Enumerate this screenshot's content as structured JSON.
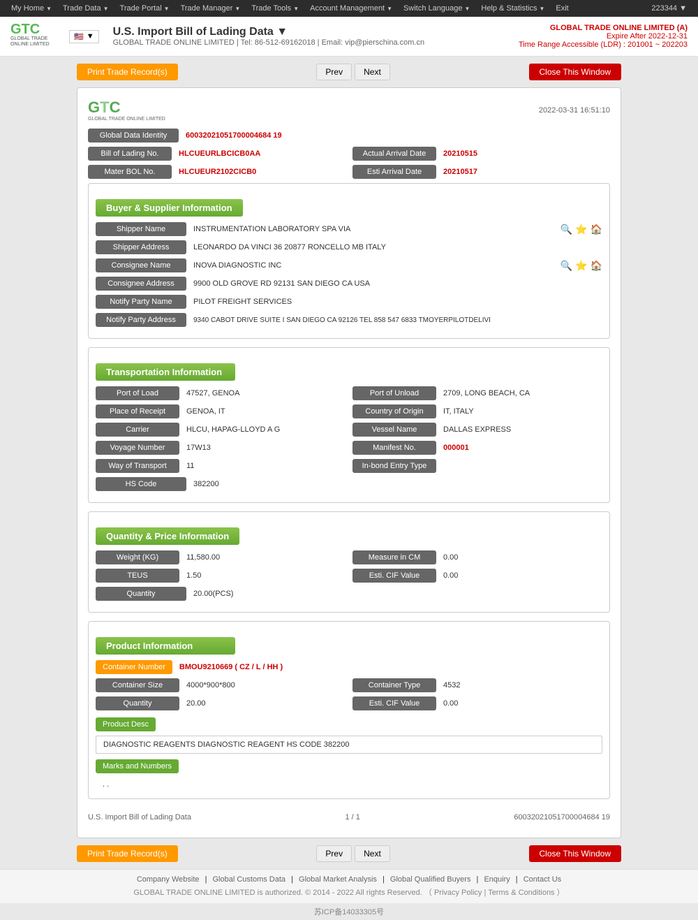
{
  "topnav": {
    "items": [
      {
        "label": "My Home",
        "arrow": true
      },
      {
        "label": "Trade Data",
        "arrow": true
      },
      {
        "label": "Trade Portal",
        "arrow": true
      },
      {
        "label": "Trade Manager",
        "arrow": true
      },
      {
        "label": "Trade Tools",
        "arrow": true
      },
      {
        "label": "Account Management",
        "arrow": true
      },
      {
        "label": "Switch Language",
        "arrow": true
      },
      {
        "label": "Help & Statistics",
        "arrow": true
      },
      {
        "label": "Exit",
        "arrow": false
      }
    ],
    "user": "223344 ▼"
  },
  "header": {
    "title": "U.S. Import Bill of Lading Data ▼",
    "subtitle": "GLOBAL TRADE ONLINE LIMITED | Tel: 86-512-69162018 | Email: vip@pierschina.com.cn",
    "company": "GLOBAL TRADE ONLINE LIMITED (A)",
    "expire": "Expire After 2022-12-31",
    "timerange": "Time Range Accessible (LDR) : 201001 ~ 202203"
  },
  "buttons": {
    "print": "Print Trade Record(s)",
    "prev": "Prev",
    "next": "Next",
    "close": "Close This Window"
  },
  "record": {
    "date": "2022-03-31 16:51:10",
    "global_data_id_label": "Global Data Identity",
    "global_data_id": "60032021051700004684 19",
    "bol_label": "Bill of Lading No.",
    "bol": "HLCUEURLBCICB0AA",
    "actual_arrival_label": "Actual Arrival Date",
    "actual_arrival": "20210515",
    "mater_bol_label": "Mater BOL No.",
    "mater_bol": "HLCUEUR2102CICB0",
    "esti_arrival_label": "Esti Arrival Date",
    "esti_arrival": "20210517"
  },
  "buyer_supplier": {
    "title": "Buyer & Supplier Information",
    "shipper_name_label": "Shipper Name",
    "shipper_name": "INSTRUMENTATION LABORATORY SPA VIA",
    "shipper_address_label": "Shipper Address",
    "shipper_address": "LEONARDO DA VINCI 36 20877 RONCELLO MB ITALY",
    "consignee_name_label": "Consignee Name",
    "consignee_name": "INOVA DIAGNOSTIC INC",
    "consignee_address_label": "Consignee Address",
    "consignee_address": "9900 OLD GROVE RD 92131 SAN DIEGO CA USA",
    "notify_party_label": "Notify Party Name",
    "notify_party": "PILOT FREIGHT SERVICES",
    "notify_address_label": "Notify Party Address",
    "notify_address": "9340 CABOT DRIVE SUITE I SAN DIEGO CA 92126 TEL 858 547 6833 TMOYERPILOTDELIVI"
  },
  "transportation": {
    "title": "Transportation Information",
    "port_load_label": "Port of Load",
    "port_load": "47527, GENOA",
    "port_unload_label": "Port of Unload",
    "port_unload": "2709, LONG BEACH, CA",
    "place_receipt_label": "Place of Receipt",
    "place_receipt": "GENOA, IT",
    "country_origin_label": "Country of Origin",
    "country_origin": "IT, ITALY",
    "carrier_label": "Carrier",
    "carrier": "HLCU, HAPAG-LLOYD A G",
    "vessel_label": "Vessel Name",
    "vessel": "DALLAS EXPRESS",
    "voyage_label": "Voyage Number",
    "voyage": "17W13",
    "manifest_label": "Manifest No.",
    "manifest": "000001",
    "way_transport_label": "Way of Transport",
    "way_transport": "11",
    "inbond_label": "In-bond Entry Type",
    "inbond": "",
    "hs_code_label": "HS Code",
    "hs_code": "382200"
  },
  "quantity_price": {
    "title": "Quantity & Price Information",
    "weight_label": "Weight (KG)",
    "weight": "11,580.00",
    "measure_label": "Measure in CM",
    "measure": "0.00",
    "teus_label": "TEUS",
    "teus": "1.50",
    "esti_cif_label": "Esti. CIF Value",
    "esti_cif": "0.00",
    "quantity_label": "Quantity",
    "quantity": "20.00(PCS)"
  },
  "product": {
    "title": "Product Information",
    "container_number_label": "Container Number",
    "container_number": "BMOU9210669 ( CZ / L / HH )",
    "container_size_label": "Container Size",
    "container_size": "4000*900*800",
    "container_type_label": "Container Type",
    "container_type": "4532",
    "quantity_label": "Quantity",
    "quantity": "20.00",
    "esti_cif_label": "Esti. CIF Value",
    "esti_cif": "0.00",
    "product_desc_label": "Product Desc",
    "product_desc": "DIAGNOSTIC REAGENTS DIAGNOSTIC REAGENT HS CODE 382200",
    "marks_label": "Marks and Numbers",
    "marks_value": ". ."
  },
  "pagination": {
    "page_info": "1 / 1",
    "record_title": "U.S. Import Bill of Lading Data",
    "record_id": "60032021051700004684 19"
  },
  "footer": {
    "links": [
      {
        "label": "Company Website"
      },
      {
        "label": "Global Customs Data"
      },
      {
        "label": "Global Market Analysis"
      },
      {
        "label": "Global Qualified Buyers"
      },
      {
        "label": "Enquiry"
      },
      {
        "label": "Contact Us"
      }
    ],
    "copy": "GLOBAL TRADE ONLINE LIMITED is authorized. © 2014 - 2022 All rights Reserved.  （",
    "privacy": "Privacy Policy",
    "separator": "|",
    "terms": "Terms & Conditions",
    "copy_end": "）",
    "icp": "苏ICP备14033305号"
  }
}
